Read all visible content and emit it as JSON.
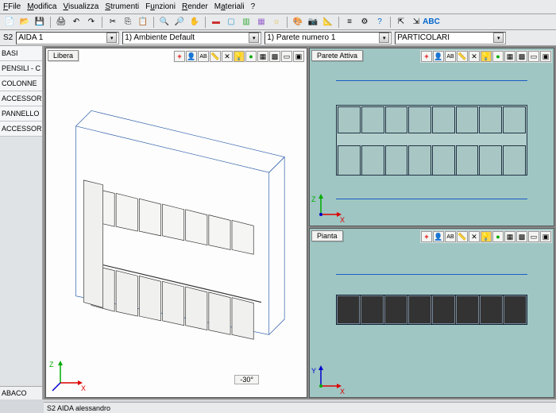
{
  "menu": {
    "file": "File",
    "modifica": "Modifica",
    "visualizza": "Visualizza",
    "strumenti": "Strumenti",
    "funzioni": "Funzioni",
    "render": "Render",
    "materiali": "Materiali",
    "help": "?"
  },
  "context": {
    "project_code": "S2",
    "project_name": "AIDA 1",
    "ambiente": "1) Ambiente Default",
    "parete": "1) Parete numero 1",
    "mode": "PARTICOLARI"
  },
  "sidebar": {
    "items": [
      "BASI",
      "PENSILI - C",
      "COLONNE",
      "ACCESSORI",
      "PANNELLO",
      "ACCESSORI"
    ],
    "bottom": "ABACO"
  },
  "panels": {
    "active_wall": {
      "title": "Parete Attiva"
    },
    "plan": {
      "title": "Pianta"
    },
    "free": {
      "title": "Libera",
      "angle": "-30°"
    }
  },
  "axes": {
    "x": "X",
    "y": "Y",
    "z": "Z"
  },
  "panel_tools": {
    "plus": "+",
    "person": "👤",
    "ab": "AB",
    "ruler": "📏",
    "tools": "✕",
    "bulb": "💡",
    "sphere": "●",
    "cube": "▦",
    "grid": "▩",
    "rect": "▭",
    "view": "▣"
  },
  "status": {
    "left": "S2 AIDA alessandro"
  }
}
